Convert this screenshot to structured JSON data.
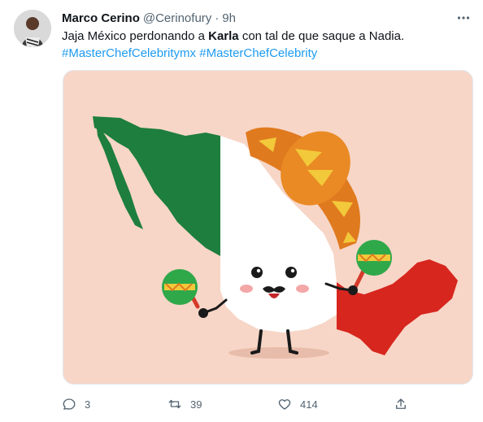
{
  "tweet": {
    "author": {
      "name": "Marco Cerino",
      "handle": "@Cerinofury",
      "separator": "·",
      "time": "9h"
    },
    "text": {
      "part1": "Jaja México perdonando a ",
      "bold": "Karla",
      "part2": " con tal de que saque a Nadia.",
      "hashtags": [
        "#MasterChefCelebritymx",
        "#MasterChefCelebrity"
      ]
    },
    "media": {
      "description_icon": "mexico-map-mascot-illustration",
      "background_color": "#f7d6c7",
      "flag_colors": {
        "green": "#1e7e3e",
        "white": "#ffffff",
        "red": "#d7261e"
      }
    },
    "actions": {
      "reply_count": "3",
      "retweet_count": "39",
      "like_count": "414"
    }
  }
}
